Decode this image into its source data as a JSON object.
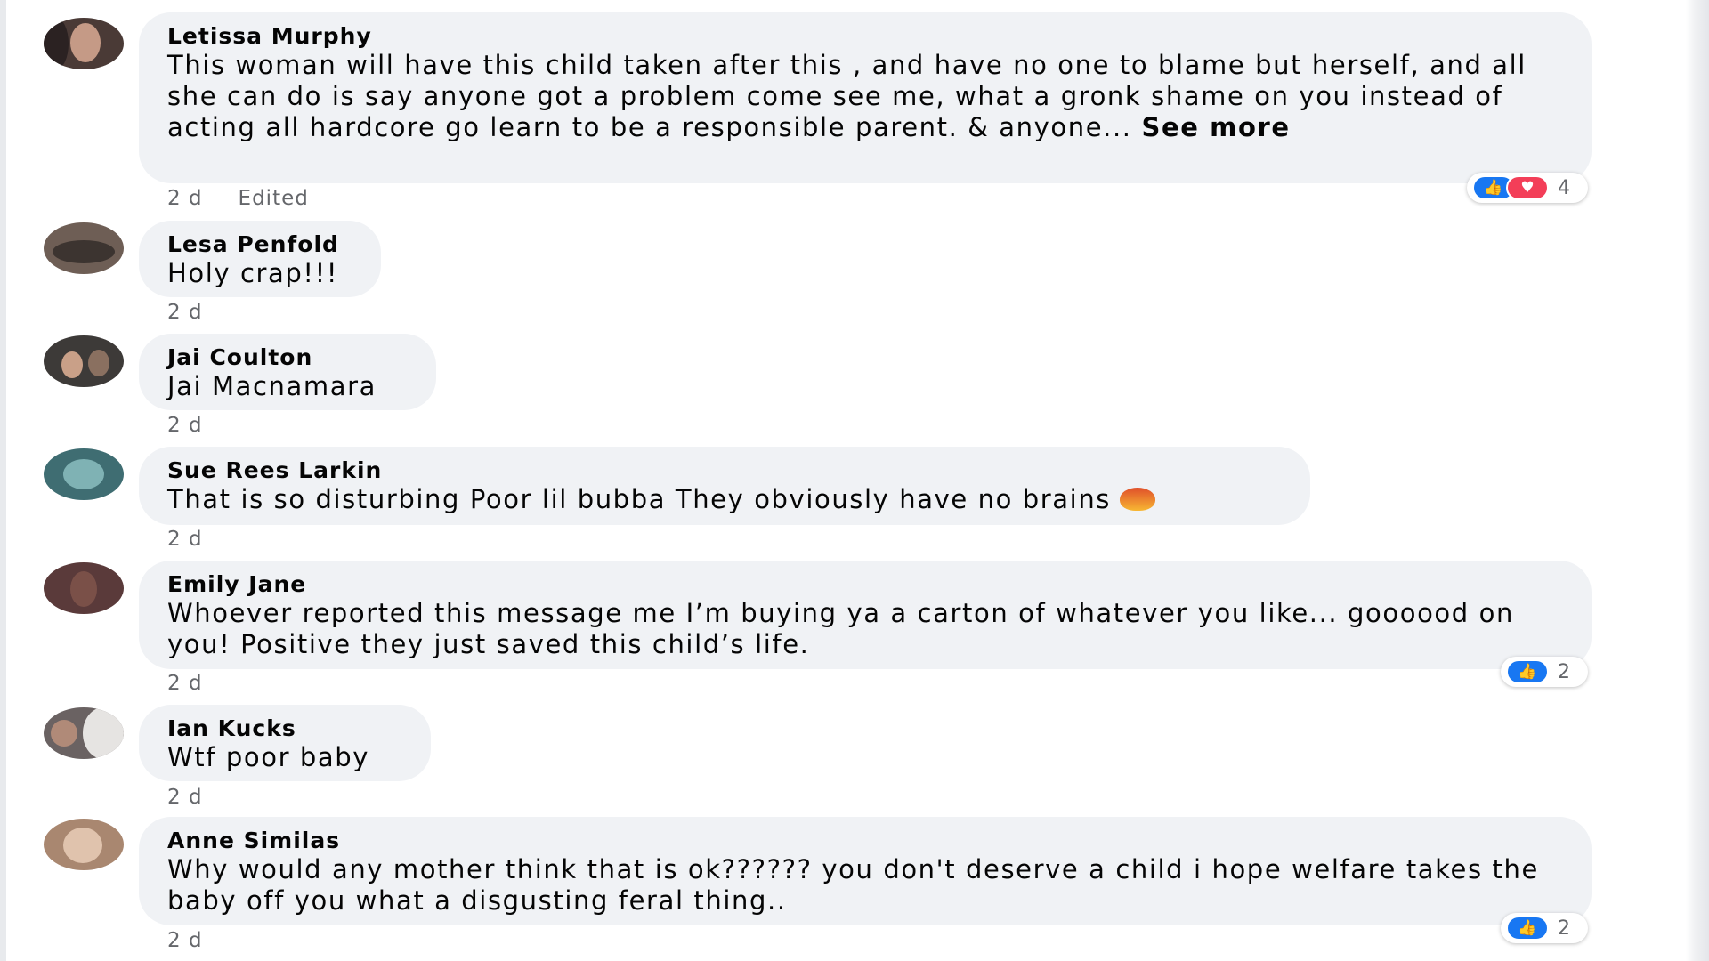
{
  "theme": {
    "bubble_bg": "#f0f2f5",
    "name_color": "#050505",
    "meta_color": "#65676b",
    "like_color": "#1877f2",
    "love_color": "#f33e58"
  },
  "comments": [
    {
      "author": "Letissa Murphy",
      "text": "This woman will have this child taken after this , and have no one to blame but herself, and all she can do is say anyone got a problem come see me, what a gronk shame on you instead of acting all hardcore go learn to be a responsible parent. & anyone...",
      "see_more": "See more",
      "time": "2 d",
      "edited": "Edited",
      "reactions": {
        "icons": [
          "like-icon",
          "love-icon"
        ],
        "count": "4"
      },
      "avatar_color": "#4a3a36"
    },
    {
      "author": "Lesa Penfold",
      "text": "Holy crap!!!",
      "time": "2 d",
      "avatar_color": "#6e5e55"
    },
    {
      "author": "Jai Coulton",
      "text": "Jai Macnamara",
      "time": "2 d",
      "avatar_color": "#3d3a38"
    },
    {
      "author": "Sue Rees Larkin",
      "text": "That is so disturbing Poor lil bubba They obviously have no brains",
      "emoji": "angry-emoji-icon",
      "time": "2 d",
      "avatar_color": "#3f6d72"
    },
    {
      "author": "Emily Jane",
      "text": "Whoever reported this message me I’m buying ya a carton of whatever you like... goooood on you! Positive they just saved this child’s life.",
      "time": "2 d",
      "reactions": {
        "icons": [
          "like-icon"
        ],
        "count": "2"
      },
      "avatar_color": "#5a3a3a"
    },
    {
      "author": "Ian Kucks",
      "text": "Wtf poor baby",
      "time": "2 d",
      "avatar_color": "#6a6262"
    },
    {
      "author": "Anne Similas",
      "text": "Why would any mother think that is ok?????? you don't deserve a child i hope welfare takes the baby off you what a disgusting feral thing..",
      "time": "2 d",
      "reactions": {
        "icons": [
          "like-icon"
        ],
        "count": "2"
      },
      "avatar_color": "#a98770"
    }
  ]
}
